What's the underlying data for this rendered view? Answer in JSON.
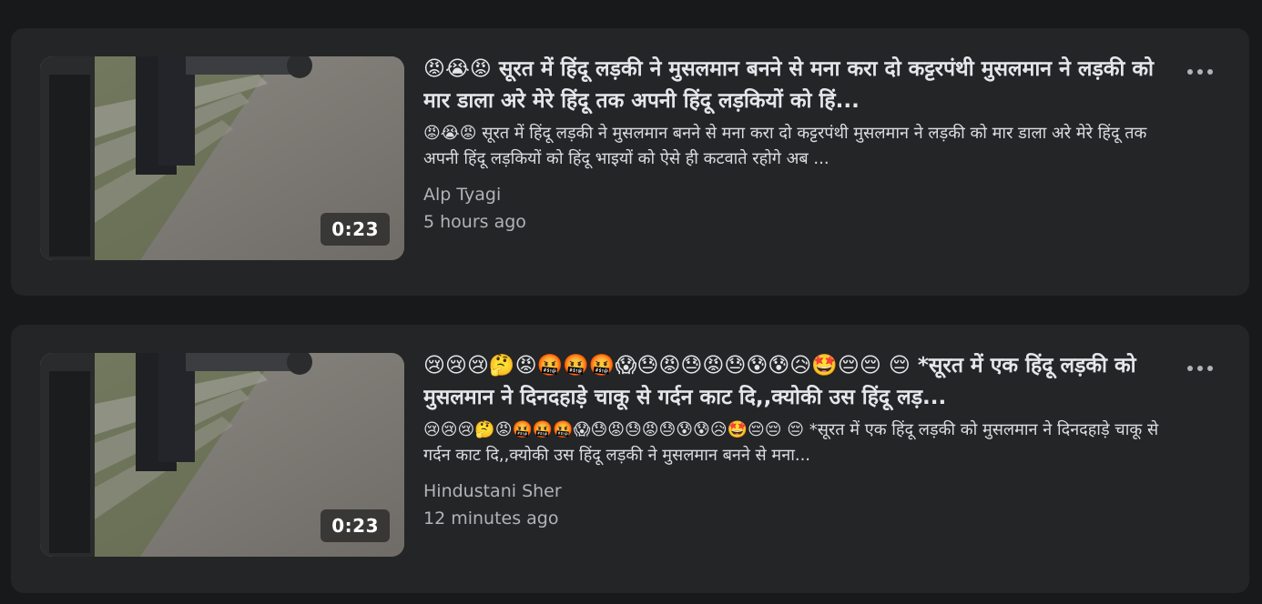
{
  "videos": [
    {
      "title": "😡😭😡 सूरत में हिंदू लड़की ने मुसलमान बनने से मना करा दो कट्टरपंथी मुसलमान ने लड़की को मार डाला अरे मेरे हिंदू तक अपनी हिंदू लड़कियों को हिं...",
      "description": "😡😭😡 सूरत में हिंदू लड़की ने मुसलमान बनने से मना करा दो कट्टरपंथी मुसलमान ने लड़की को मार डाला अरे मेरे हिंदू तक अपनी हिंदू लड़कियों को हिंदू भाइयों को ऐसे ही कटवाते रहोगे अब ...",
      "duration": "0:23",
      "author": "Alp Tyagi",
      "time": "5 hours ago"
    },
    {
      "title": "😢😢😢🤔😡🤬🤬🤬😱😓😡😓😡😓😰😰😥🤩😔😔 😔 *सूरत में एक हिंदू लड़की को मुसलमान ने दिनदहाड़े चाकू से गर्दन काट दि,,क्योकी उस हिंदू लड़...",
      "description": "😢😢😢🤔😡🤬🤬🤬😱😓😡😓😡😓😰😰😥🤩😔😔 😔 *सूरत में एक हिंदू लड़की को मुसलमान ने दिनदहाड़े चाकू से गर्दन काट दि,,क्योकी उस हिंदू लड़की ने मुसलमान बनने से मना...",
      "duration": "0:23",
      "author": "Hindustani Sher",
      "time": "12 minutes ago"
    }
  ]
}
